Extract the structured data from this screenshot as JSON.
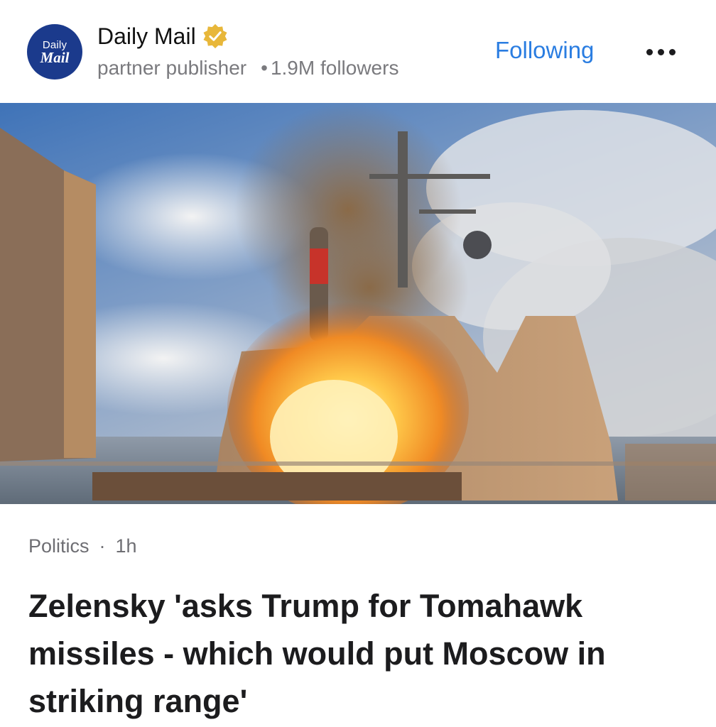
{
  "publisher": {
    "logo_line1": "Daily",
    "logo_line2": "Mail",
    "name": "Daily Mail",
    "verified_icon": "verified-badge-icon",
    "type": "partner publisher",
    "followers": "1.9M followers",
    "separator": "•"
  },
  "actions": {
    "follow_label": "Following",
    "more_icon": "more-options-icon"
  },
  "article": {
    "category": "Politics",
    "separator": "·",
    "age": "1h",
    "headline": "Zelensky 'asks Trump for Tomahawk missiles - which would put Moscow in striking range'"
  },
  "colors": {
    "accent": "#2a7de1",
    "logo_bg": "#1b3a8c",
    "verified": "#e8b73a"
  }
}
